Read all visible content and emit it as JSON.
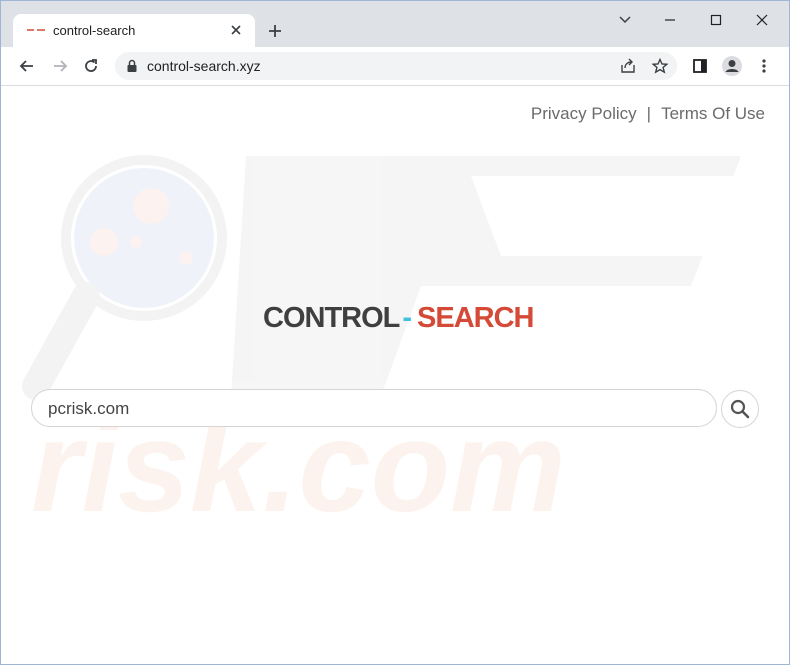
{
  "browser": {
    "tab": {
      "title": "control-search"
    },
    "address_bar": {
      "url": "control-search.xyz"
    },
    "icons": [
      "back-arrow-icon",
      "forward-arrow-icon",
      "reload-icon",
      "lock-icon",
      "share-icon",
      "star-icon",
      "side-panel-icon",
      "profile-icon",
      "menu-icon",
      "minimize-icon",
      "maximize-icon",
      "close-icon",
      "new-tab-icon"
    ]
  },
  "page": {
    "links": {
      "privacy": "Privacy Policy",
      "separator": "|",
      "terms": "Terms Of Use"
    },
    "logo": {
      "part1": "CONTROL",
      "dash": "-",
      "part2": "SEARCH"
    },
    "search": {
      "value": "pcrisk.com"
    },
    "colors": {
      "logo_dark": "#3f3f3f",
      "logo_dash": "#3ec1e0",
      "logo_accent": "#d44a37"
    }
  }
}
